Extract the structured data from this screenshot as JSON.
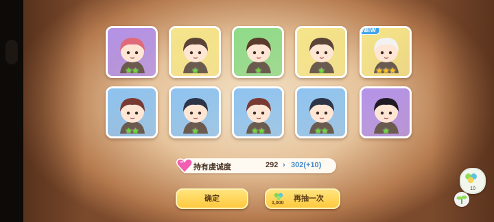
{
  "results": [
    {
      "rarity": "2-star",
      "frame_color": "#b493e8",
      "is_new": false,
      "stars": 2,
      "star_color": "green",
      "hair": "#e06a7a"
    },
    {
      "rarity": "2-star",
      "frame_color": "#f5e58a",
      "is_new": false,
      "stars": 1,
      "star_color": "green",
      "hair": "#5a4438"
    },
    {
      "rarity": "2-star",
      "frame_color": "#8fdc8a",
      "is_new": false,
      "stars": 1,
      "star_color": "green",
      "hair": "#5a3a2c"
    },
    {
      "rarity": "2-star",
      "frame_color": "#f5e58a",
      "is_new": false,
      "stars": 1,
      "star_color": "green",
      "hair": "#5a4438"
    },
    {
      "rarity": "3-star",
      "frame_color": "#f5e58a",
      "is_new": true,
      "stars": 3,
      "star_color": "gold",
      "hair": "#f2f2f2"
    },
    {
      "rarity": "2-star",
      "frame_color": "#8ec3f0",
      "is_new": false,
      "stars": 2,
      "star_color": "green",
      "hair": "#7a3a34"
    },
    {
      "rarity": "2-star",
      "frame_color": "#8ec3f0",
      "is_new": false,
      "stars": 1,
      "star_color": "green",
      "hair": "#2d3448"
    },
    {
      "rarity": "2-star",
      "frame_color": "#8ec3f0",
      "is_new": false,
      "stars": 2,
      "star_color": "green",
      "hair": "#7a3a34"
    },
    {
      "rarity": "2-star",
      "frame_color": "#8ec3f0",
      "is_new": false,
      "stars": 2,
      "star_color": "green",
      "hair": "#2d3448"
    },
    {
      "rarity": "2-star",
      "frame_color": "#b493e8",
      "is_new": false,
      "stars": 1,
      "star_color": "green",
      "hair": "#1f1a24"
    }
  ],
  "new_badge_text": "NEW",
  "loyalty": {
    "label": "持有虔诚度",
    "old_value": "292",
    "arrow": "›",
    "new_value": "302(+10)"
  },
  "buttons": {
    "confirm_label": "确定",
    "again_label": "再抽一次",
    "again_cost": "1,000"
  },
  "side": {
    "item_count": "10"
  },
  "icons": [
    "heart-gem-icon",
    "clover-currency-icon",
    "clover-item-icon",
    "sprout-icon",
    "star-icon"
  ]
}
